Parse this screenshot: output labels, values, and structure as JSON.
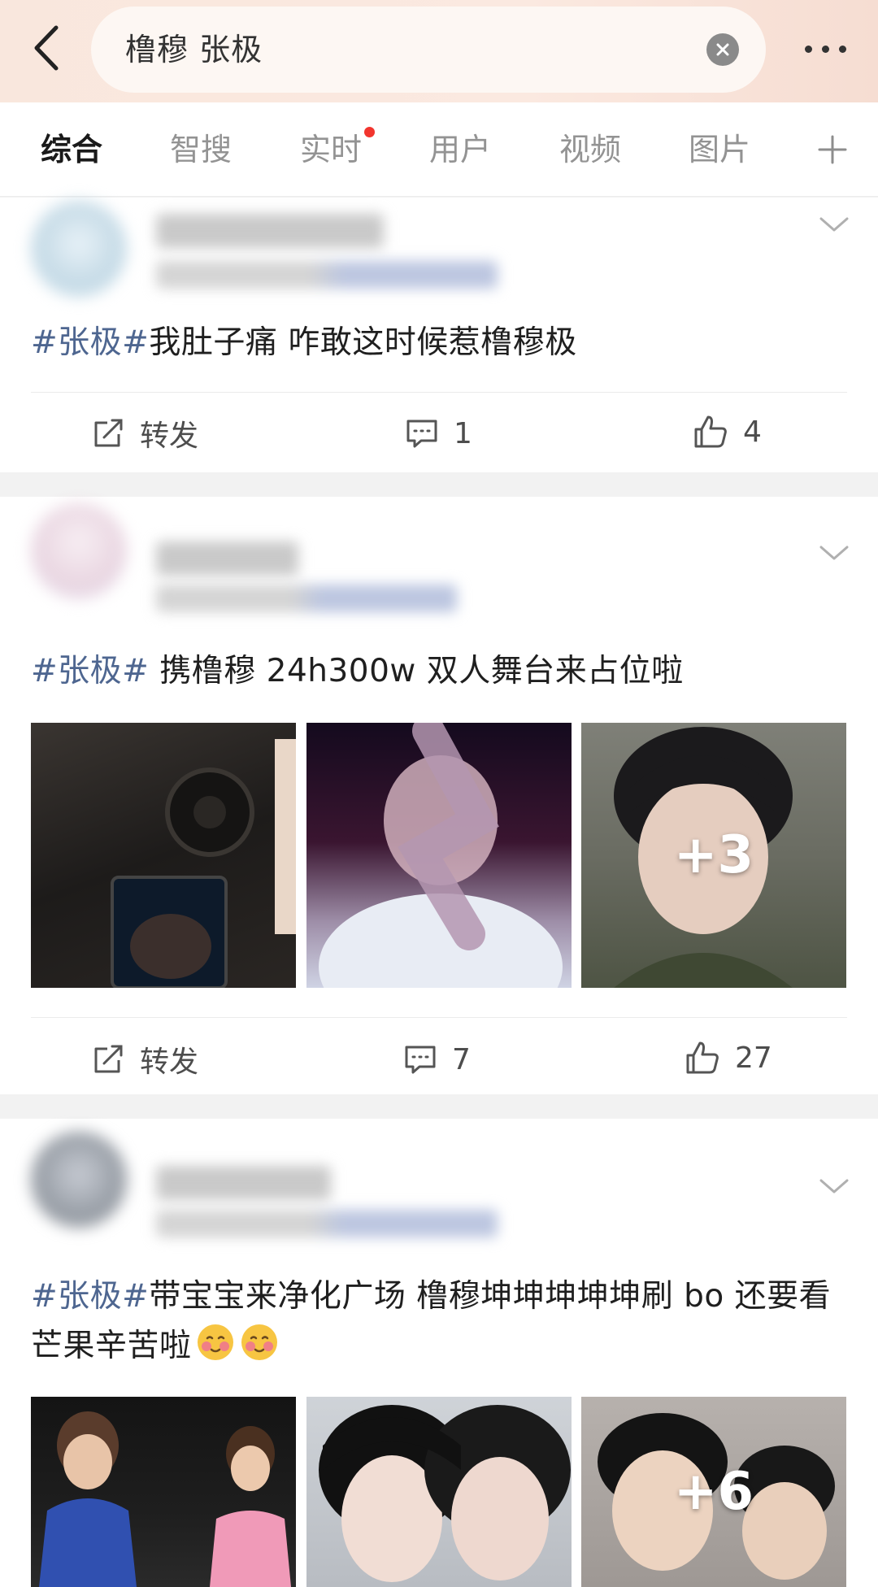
{
  "search": {
    "query": "橹穆 张极"
  },
  "tabs": [
    {
      "label": "综合",
      "active": true
    },
    {
      "label": "智搜"
    },
    {
      "label": "实时",
      "dot": true
    },
    {
      "label": "用户"
    },
    {
      "label": "视频"
    },
    {
      "label": "图片"
    }
  ],
  "posts": [
    {
      "hashtag": "#张极#",
      "text": "我肚子痛 咋敢这时候惹橹穆极",
      "repost_label": "转发",
      "comments": "1",
      "likes": "4"
    },
    {
      "hashtag": "#张极#",
      "text": " 携橹穆 24h300w 双人舞台来占位啦",
      "image_more": "+3",
      "repost_label": "转发",
      "comments": "7",
      "likes": "27"
    },
    {
      "hashtag": "#张极#",
      "text": "带宝宝来净化广场 橹穆坤坤坤坤坤刷 bo 还要看芒果辛苦啦",
      "image_more": "+6"
    }
  ],
  "colors": {
    "hashtag": "#4e6690",
    "tab_dot": "#f2352e",
    "header_bg": "#f9e7dd"
  },
  "icons": [
    "back-icon",
    "clear-icon",
    "more-icon",
    "plus-icon",
    "chevron-down-icon",
    "repost-icon",
    "comment-icon",
    "like-icon",
    "blush-emoji-icon"
  ]
}
